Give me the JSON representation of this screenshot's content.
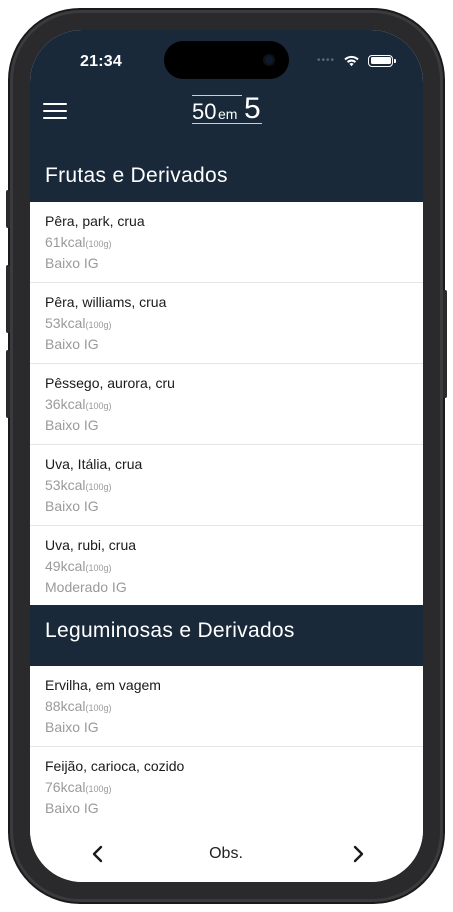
{
  "status_bar": {
    "time": "21:34"
  },
  "logo": {
    "part1": "50",
    "part2": "em",
    "part3": "5"
  },
  "sections": [
    {
      "title": "Frutas e Derivados",
      "items": [
        {
          "name": "Pêra, park, crua",
          "kcal": "61kcal",
          "unit": "(100g)",
          "ig": "Baixo IG"
        },
        {
          "name": "Pêra, williams, crua",
          "kcal": "53kcal",
          "unit": "(100g)",
          "ig": "Baixo IG"
        },
        {
          "name": "Pêssego, aurora, cru",
          "kcal": "36kcal",
          "unit": "(100g)",
          "ig": "Baixo IG"
        },
        {
          "name": "Uva, Itália, crua",
          "kcal": "53kcal",
          "unit": "(100g)",
          "ig": "Baixo IG"
        },
        {
          "name": "Uva, rubi, crua",
          "kcal": "49kcal",
          "unit": "(100g)",
          "ig": "Moderado IG"
        }
      ]
    },
    {
      "title": "Leguminosas e Derivados",
      "items": [
        {
          "name": "Ervilha, em vagem",
          "kcal": "88kcal",
          "unit": "(100g)",
          "ig": "Baixo IG"
        },
        {
          "name": "Feijão, carioca, cozido",
          "kcal": "76kcal",
          "unit": "(100g)",
          "ig": "Baixo IG"
        }
      ]
    }
  ],
  "bottom_bar": {
    "center_label": "Obs."
  },
  "icons": {
    "menu": "hamburger-menu-icon",
    "prev": "chevron-left-icon",
    "next": "chevron-right-icon"
  },
  "colors": {
    "header_bg": "#19293a",
    "secondary_text": "#9a9a9a"
  }
}
